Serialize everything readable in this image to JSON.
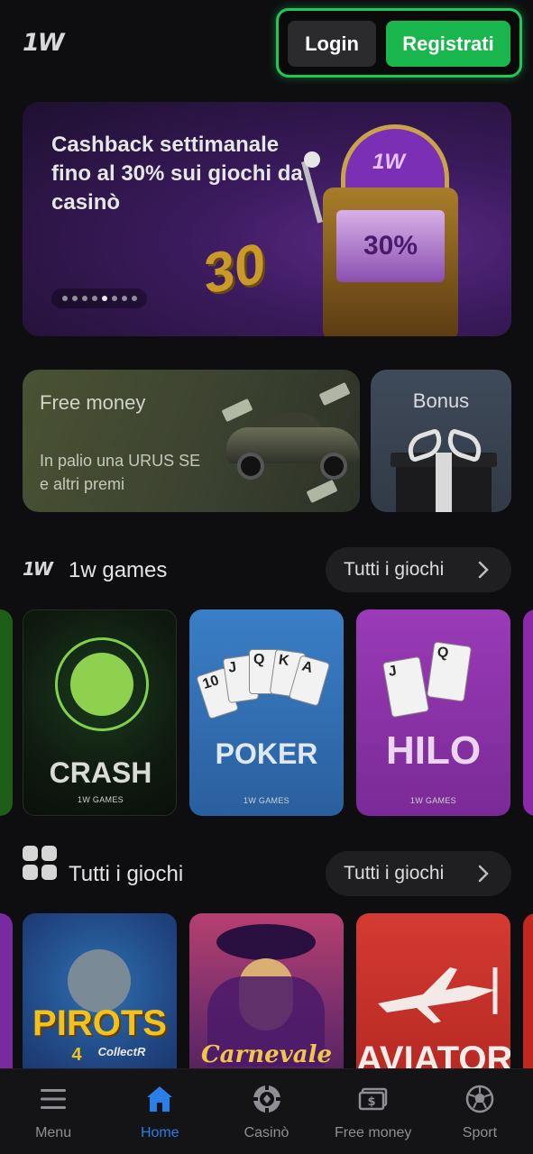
{
  "header": {
    "logo": "1W",
    "login_label": "Login",
    "register_label": "Registrati"
  },
  "hero": {
    "title": "Cashback settimanale fino al 30% sui giochi da casinò",
    "slide_count": 8,
    "active_slide": 5,
    "art_text_1": "1W",
    "art_text_2": "30%",
    "art_text_3": "30"
  },
  "promos": {
    "free_money": {
      "title": "Free money",
      "subtitle": "In palio una URUS SE e altri premi"
    },
    "bonus": {
      "title": "Bonus"
    }
  },
  "sections": {
    "onew_games": {
      "logo": "1W",
      "title": "1w games",
      "button": "Tutti i giochi"
    },
    "all_games": {
      "title": "Tutti i giochi",
      "button": "Tutti i giochi"
    }
  },
  "onew_games": [
    {
      "name": "CRASH",
      "provider": "1W GAMES"
    },
    {
      "name": "POKER",
      "provider": "1W GAMES"
    },
    {
      "name": "HILO",
      "provider": "1W GAMES"
    }
  ],
  "all_games": [
    {
      "name": "PIROTS",
      "subtitle": "CollectR",
      "number": "4"
    },
    {
      "name": "Carnevale"
    },
    {
      "name": "AVIATOR"
    }
  ],
  "bottom_nav": [
    {
      "label": "Menu",
      "icon": "hamburger-icon"
    },
    {
      "label": "Home",
      "icon": "home-icon",
      "active": true
    },
    {
      "label": "Casinò",
      "icon": "casino-chip-icon"
    },
    {
      "label": "Free money",
      "icon": "money-bill-icon"
    },
    {
      "label": "Sport",
      "icon": "soccer-ball-icon"
    }
  ],
  "colors": {
    "accent_green": "#18b64c",
    "active_nav": "#2a7ee8",
    "background": "#0e0e10"
  }
}
